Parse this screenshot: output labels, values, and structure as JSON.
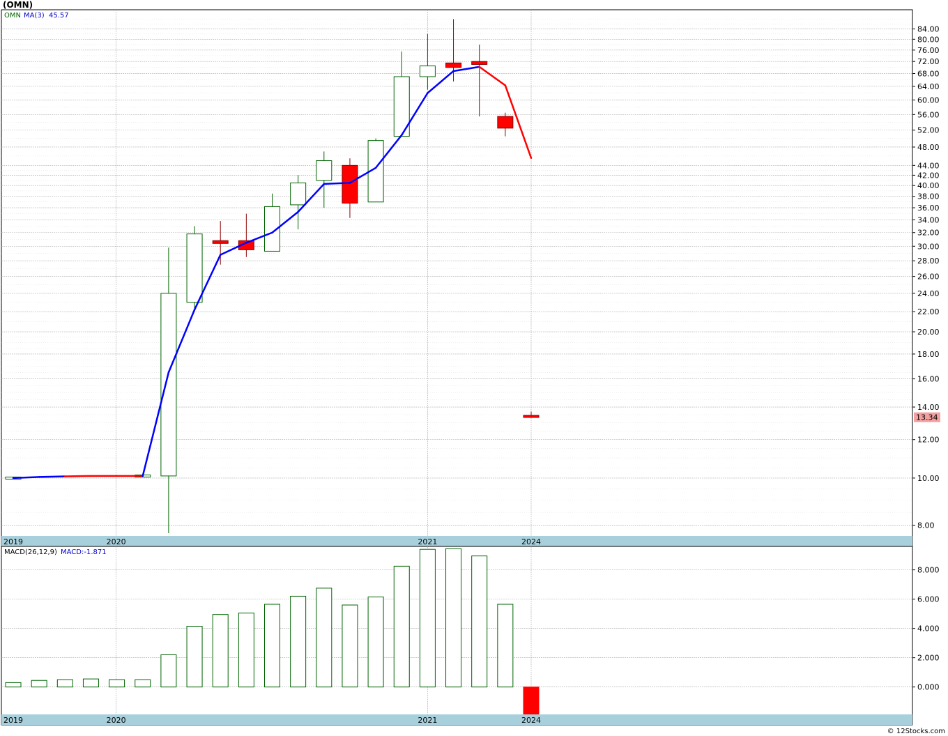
{
  "title": "(OMN)",
  "credit": "© 12Stocks.com",
  "colors": {
    "up_candle_outline": "#006400",
    "down_candle_fill": "#ff0000",
    "ma_rising": "#0000ff",
    "ma_falling": "#ff0000",
    "axis_band": "#a8d0dc",
    "grid": "#aaaaaa",
    "last_price_box": "#f4a0a0",
    "macd_bar_up": "#006400",
    "macd_bar_down": "#ff0000"
  },
  "chart_data": [
    {
      "type": "candlestick",
      "name": "price",
      "legend": {
        "symbol": "OMN",
        "ma_label": "MA(3)",
        "ma_value": "45.57"
      },
      "scale": "log",
      "ylim": [
        7.6,
        92
      ],
      "y_ticks": [
        "8.00",
        "10.00",
        "12.00",
        "14.00",
        "16.00",
        "18.00",
        "20.00",
        "22.00",
        "24.00",
        "26.00",
        "28.00",
        "30.00",
        "32.00",
        "34.00",
        "36.00",
        "38.00",
        "40.00",
        "42.00",
        "44.00",
        "48.00",
        "52.00",
        "56.00",
        "60.00",
        "64.00",
        "68.00",
        "72.00",
        "76.00",
        "80.00",
        "84.00"
      ],
      "x_labels": [
        {
          "label": "2019",
          "index": 0
        },
        {
          "label": "2020",
          "index": 4
        },
        {
          "label": "2021",
          "index": 16
        },
        {
          "label": "2024",
          "index": 20
        }
      ],
      "last_price": "13.34",
      "candles": [
        {
          "i": 0,
          "o": 10.0,
          "h": 10.0,
          "l": 10.0,
          "c": 10.0
        },
        {
          "i": 5,
          "o": 10.1,
          "h": 10.1,
          "l": 10.1,
          "c": 10.1
        },
        {
          "i": 6,
          "o": 10.1,
          "h": 29.8,
          "l": 7.7,
          "c": 24.0
        },
        {
          "i": 7,
          "o": 23.0,
          "h": 33.0,
          "l": 22.0,
          "c": 31.8
        },
        {
          "i": 8,
          "o": 30.8,
          "h": 33.8,
          "l": 27.5,
          "c": 30.4
        },
        {
          "i": 9,
          "o": 30.8,
          "h": 35.0,
          "l": 28.5,
          "c": 29.5
        },
        {
          "i": 10,
          "o": 29.3,
          "h": 38.5,
          "l": 29.3,
          "c": 36.2
        },
        {
          "i": 11,
          "o": 36.5,
          "h": 42.0,
          "l": 32.5,
          "c": 40.5
        },
        {
          "i": 12,
          "o": 41.0,
          "h": 47.0,
          "l": 36.0,
          "c": 45.0
        },
        {
          "i": 13,
          "o": 44.0,
          "h": 45.5,
          "l": 34.3,
          "c": 36.8
        },
        {
          "i": 14,
          "o": 37.0,
          "h": 50.0,
          "l": 37.0,
          "c": 49.5
        },
        {
          "i": 15,
          "o": 50.5,
          "h": 75.5,
          "l": 50.5,
          "c": 67.0
        },
        {
          "i": 16,
          "o": 67.0,
          "h": 82.0,
          "l": 63.0,
          "c": 70.5
        },
        {
          "i": 17,
          "o": 71.5,
          "h": 88.0,
          "l": 65.5,
          "c": 70.0
        },
        {
          "i": 18,
          "o": 72.0,
          "h": 78.0,
          "l": 55.5,
          "c": 71.0
        },
        {
          "i": 19,
          "o": 55.5,
          "h": 56.5,
          "l": 50.5,
          "c": 52.5
        },
        {
          "i": 20,
          "o": 13.45,
          "h": 13.7,
          "l": 13.3,
          "c": 13.34
        }
      ],
      "ma": [
        {
          "i": 0,
          "v": 10.0
        },
        {
          "i": 1,
          "v": 10.05
        },
        {
          "i": 2,
          "v": 10.08
        },
        {
          "i": 3,
          "v": 10.1
        },
        {
          "i": 4,
          "v": 10.1
        },
        {
          "i": 5,
          "v": 10.1
        },
        {
          "i": 6,
          "v": 16.5
        },
        {
          "i": 7,
          "v": 22.2
        },
        {
          "i": 8,
          "v": 28.8
        },
        {
          "i": 9,
          "v": 30.5
        },
        {
          "i": 10,
          "v": 32.0
        },
        {
          "i": 11,
          "v": 35.3
        },
        {
          "i": 12,
          "v": 40.3
        },
        {
          "i": 13,
          "v": 40.5
        },
        {
          "i": 14,
          "v": 43.5
        },
        {
          "i": 15,
          "v": 50.8
        },
        {
          "i": 16,
          "v": 62.0
        },
        {
          "i": 17,
          "v": 68.8
        },
        {
          "i": 18,
          "v": 70.2
        },
        {
          "i": 19,
          "v": 64.3
        },
        {
          "i": 20,
          "v": 45.57
        }
      ]
    },
    {
      "type": "bar",
      "name": "macd",
      "legend": {
        "label": "MACD(26,12,9)",
        "value_label": "MACD:-1.871"
      },
      "ylim": [
        -1.871,
        9.6
      ],
      "y_ticks": [
        "0.000",
        "2.000",
        "4.000",
        "6.000",
        "8.000"
      ],
      "x_labels": [
        {
          "label": "2019",
          "index": 0
        },
        {
          "label": "2020",
          "index": 4
        },
        {
          "label": "2021",
          "index": 16
        },
        {
          "label": "2024",
          "index": 20
        }
      ],
      "bars": [
        {
          "i": 0,
          "v": 0.3
        },
        {
          "i": 1,
          "v": 0.45
        },
        {
          "i": 2,
          "v": 0.5
        },
        {
          "i": 3,
          "v": 0.55
        },
        {
          "i": 4,
          "v": 0.5
        },
        {
          "i": 5,
          "v": 0.5
        },
        {
          "i": 6,
          "v": 2.2
        },
        {
          "i": 7,
          "v": 4.15
        },
        {
          "i": 8,
          "v": 4.95
        },
        {
          "i": 9,
          "v": 5.05
        },
        {
          "i": 10,
          "v": 5.65
        },
        {
          "i": 11,
          "v": 6.2
        },
        {
          "i": 12,
          "v": 6.75
        },
        {
          "i": 13,
          "v": 5.6
        },
        {
          "i": 14,
          "v": 6.15
        },
        {
          "i": 15,
          "v": 8.25
        },
        {
          "i": 16,
          "v": 9.4
        },
        {
          "i": 17,
          "v": 9.45
        },
        {
          "i": 18,
          "v": 8.95
        },
        {
          "i": 19,
          "v": 5.65
        },
        {
          "i": 20,
          "v": -1.871
        }
      ]
    }
  ]
}
